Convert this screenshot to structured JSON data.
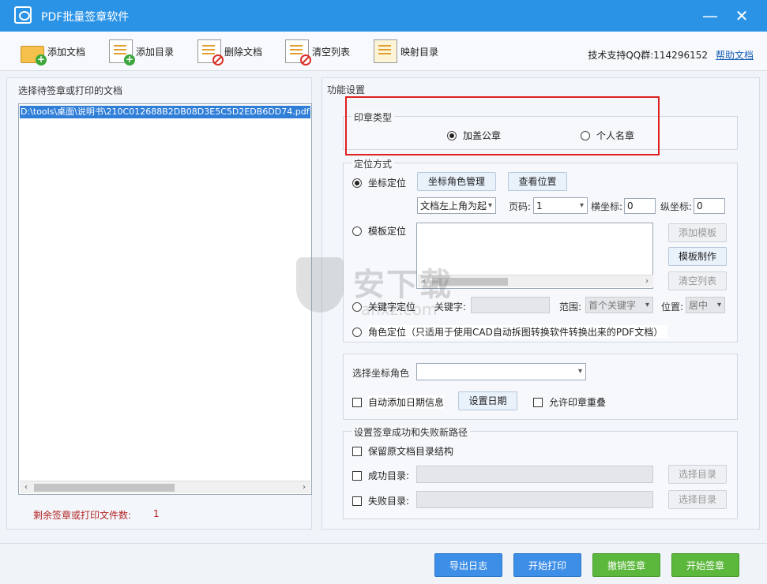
{
  "window": {
    "title": "PDF批量签章软件",
    "minimize": "—",
    "close": "✕"
  },
  "toolbar": {
    "add_doc": "添加文档",
    "add_dir": "添加目录",
    "delete_doc": "删除文档",
    "clear_list": "清空列表",
    "map_dir": "映射目录",
    "support": "技术支持QQ群:114296152",
    "help": "帮助文档"
  },
  "left": {
    "title": "选择待签章或打印的文档",
    "files": [
      "D:\\tools\\桌面\\说明书\\210C012688B2DB08D3E5C5D2EDB6DD74.pdf"
    ],
    "remaining_label": "剩余签章或打印文件数:",
    "remaining_count": "1"
  },
  "right": {
    "title": "功能设置",
    "seal_type": {
      "title": "印章类型",
      "official": "加盖公章",
      "personal": "个人名章"
    },
    "positioning": {
      "title": "定位方式",
      "coord": "坐标定位",
      "coord_role_btn": "坐标角色管理",
      "view_pos_btn": "查看位置",
      "anchor_select": "文档左上角为起",
      "page_label": "页码:",
      "page_value": "1",
      "x_label": "横坐标:",
      "x_value": "0",
      "y_label": "纵坐标:",
      "y_value": "0",
      "template": "模板定位",
      "add_template_btn": "添加模板",
      "make_template_btn": "模板制作",
      "clear_list_btn": "清空列表",
      "keyword": "关键字定位",
      "keyword_label": "关键字:",
      "range_label": "范围:",
      "range_value": "首个关键字",
      "position_label": "位置:",
      "position_value": "居中",
      "role": "角色定位（只适用于使用CAD自动拆图转换软件转换出来的PDF文档）"
    },
    "select_role_label": "选择坐标角色",
    "auto_date": "自动添加日期信息",
    "set_date_btn": "设置日期",
    "allow_overlap": "允许印章重叠",
    "path": {
      "title": "设置签章成功和失败新路径",
      "keep_structure": "保留原文档目录结构",
      "success": "成功目录:",
      "fail": "失败目录:",
      "choose_btn": "选择目录"
    }
  },
  "bottom": {
    "export_log": "导出日志",
    "start_print": "开始打印",
    "cancel_sign": "撤销签章",
    "start_sign": "开始签章"
  },
  "watermark": {
    "main": "安下载",
    "sub": "anxz.com"
  },
  "colors": {
    "titlebar": "#2b93e6",
    "blue_btn": "#3d8ee6",
    "green_btn": "#5cb83c",
    "highlight": "#e02020"
  }
}
